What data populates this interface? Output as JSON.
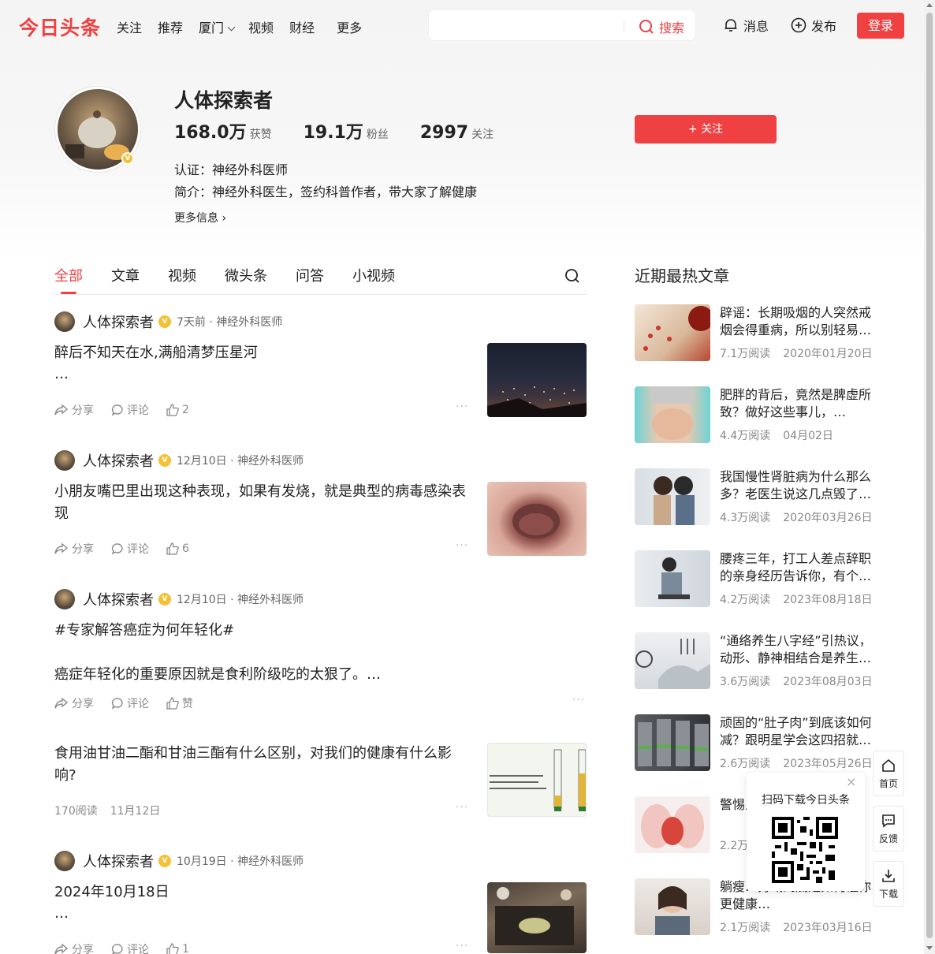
{
  "header": {
    "logo": "今日头条",
    "nav": [
      "关注",
      "推荐",
      "厦门",
      "视频",
      "财经",
      "更多"
    ],
    "search_button": "搜索",
    "search_placeholder": "",
    "messages": "消息",
    "publish": "发布",
    "login": "登录"
  },
  "profile": {
    "name": "人体探索者",
    "likes_num": "168.0万",
    "likes_label": "获赞",
    "fans_num": "19.1万",
    "fans_label": "粉丝",
    "following_num": "2997",
    "following_label": "关注",
    "certification": "认证：神经外科医师",
    "intro": "简介：神经外科医生，签约科普作者，带大家了解健康",
    "more_info": "更多信息",
    "follow_button": "+ 关注"
  },
  "tabs": [
    "全部",
    "文章",
    "视频",
    "微头条",
    "问答",
    "小视频"
  ],
  "feed": [
    {
      "author": "人体探索者",
      "meta": "7天前 · 神经外科医师",
      "title": "醉后不知天在水,满船清梦压星河",
      "ellipsis": "…",
      "share": "分享",
      "comment": "评论",
      "like": "2"
    },
    {
      "author": "人体探索者",
      "meta": "12月10日 · 神经外科医师",
      "title": "小朋友嘴巴里出现这种表现，如果有发烧，就是典型的病毒感染表现",
      "share": "分享",
      "comment": "评论",
      "like": "6"
    },
    {
      "author": "人体探索者",
      "meta": "12月10日 · 神经外科医师",
      "title": "#专家解答癌症为何年轻化#",
      "body": "癌症年轻化的重要原因就是食利阶级吃的太狠了。…",
      "share": "分享",
      "comment": "评论",
      "like": "赞"
    },
    {
      "title": "食用油甘油二酯和甘油三酯有什么区别，对我们的健康有什么影响?",
      "reads": "170阅读",
      "date": "11月12日"
    },
    {
      "author": "人体探索者",
      "meta": "10月19日 · 神经外科医师",
      "title": "2024年10月18日",
      "ellipsis": "…",
      "share": "分享",
      "comment": "评论",
      "like": "1"
    }
  ],
  "sidebar": {
    "title": "近期最热文章",
    "articles": [
      {
        "title": "辟谣：长期吸烟的人突然戒烟会得重病，所以别轻易…",
        "reads": "7.1万阅读",
        "date": "2020年01月20日"
      },
      {
        "title": "肥胖的背后，竟然是脾虚所致？做好这些事儿，…",
        "reads": "4.4万阅读",
        "date": "04月02日"
      },
      {
        "title": "我国慢性肾脏病为什么那么多？老医生说这几点毁了…",
        "reads": "4.3万阅读",
        "date": "2020年03月26日"
      },
      {
        "title": "腰疼三年，打工人差点辞职的亲身经历告诉你，有个…",
        "reads": "4.2万阅读",
        "date": "2023年08月18日"
      },
      {
        "title": "“通络养生八字经”引热议，动形、静神相结合是养生…",
        "reads": "3.6万阅读",
        "date": "2023年08月03日"
      },
      {
        "title": "顽固的“肚子肉”到底该如何减？跟明星学会这四招就…",
        "reads": "2.6万阅读",
        "date": "2023年05月26日"
      },
      {
        "title": "警惕人体“生…",
        "reads": "2.2万",
        "date": ""
      },
      {
        "title": "躺瘦…秀域到底是如何让你更健康…",
        "reads": "2.1万阅读",
        "date": "2023年03月16日"
      }
    ]
  },
  "float": {
    "home": "首页",
    "feedback": "反馈",
    "download": "下载"
  },
  "qr": {
    "title": "扫码下载今日头条",
    "close": "×"
  },
  "colors": {
    "accent": "#f04142",
    "badge": "#f5c034"
  }
}
